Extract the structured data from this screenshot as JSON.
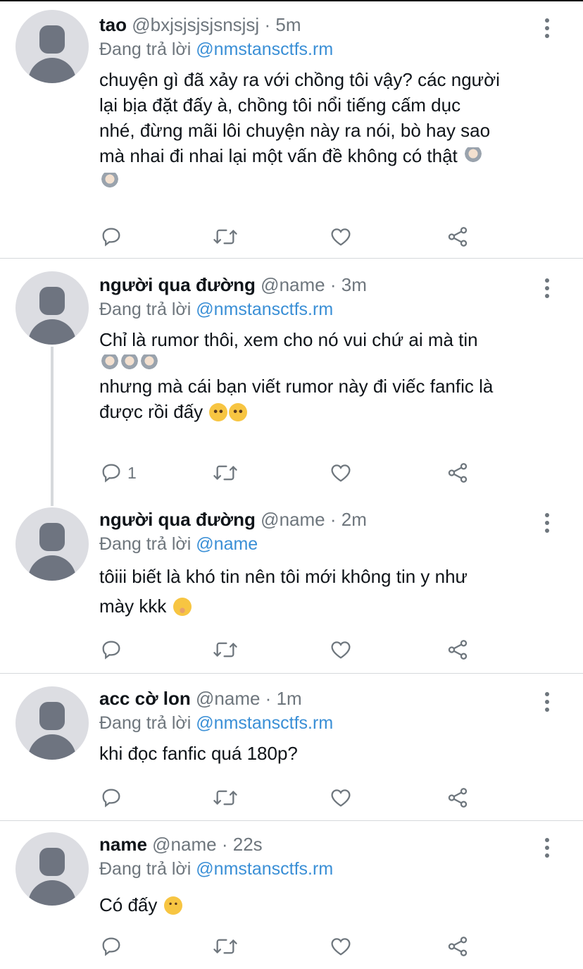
{
  "tweets": [
    {
      "name": "tao",
      "handle": "@bxjsjsjsjsnsjsj",
      "time": "5m",
      "reply_prefix": "Đang trả lời",
      "reply_to": "@nmstansctfs.rm",
      "lines": [
        "chuyện gì đã xảy ra với chồng tôi vậy? các người",
        "lại bịa đặt đấy à, chồng tôi nổi tiếng cấm dục",
        "nhé, đừng mãi lôi chuyện này ra nói, bò hay sao",
        "mà nhai đi nhai lại một vấn đề không có thật"
      ],
      "emoji_line1": "person-shrugging-emoji",
      "emoji_line2": "person-shrugging-emoji"
    },
    {
      "name": "người qua đường",
      "handle": "@name",
      "time": "3m",
      "reply_prefix": "Đang trả lời",
      "reply_to": "@nmstansctfs.rm",
      "lines": [
        "Chỉ là rumor thôi, xem cho nó vui chứ ai mà tin",
        "nhưng mà cái bạn viết rumor này đi viếc fanfic là",
        "được rồi đấy"
      ],
      "reply_count": "1"
    },
    {
      "name": "người qua đường",
      "handle": "@name",
      "time": "2m",
      "reply_prefix": "Đang trả lời",
      "reply_to": "@name",
      "lines": [
        "tôiii biết là khó tin nên tôi mới không tin y như",
        "mày kkk"
      ]
    },
    {
      "name": "acc cờ lon",
      "handle": "@name",
      "time": "1m",
      "reply_prefix": "Đang trả lời",
      "reply_to": "@nmstansctfs.rm",
      "lines": [
        "khi đọc fanfic quá 180p?"
      ]
    },
    {
      "name": "name",
      "handle": "@name",
      "time": "22s",
      "reply_prefix": "Đang trả lời",
      "reply_to": "@nmstansctfs.rm",
      "lines": [
        "Có đấy"
      ]
    }
  ],
  "separator": "·",
  "icons": {
    "reply": "comment-icon",
    "retweet": "retweet-icon",
    "like": "heart-icon",
    "share": "share-icon",
    "more": "more-vertical-icon",
    "avatar": "default-avatar"
  },
  "colors": {
    "link": "#3a8fd6",
    "muted": "#6e767d",
    "text": "#0f1419",
    "divider": "#d6d9dc"
  }
}
